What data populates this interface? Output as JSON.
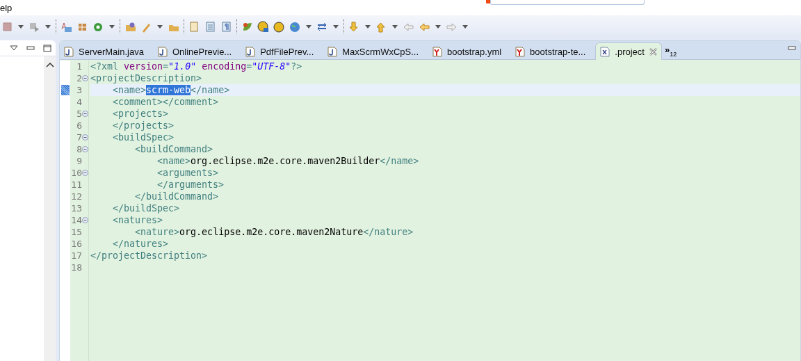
{
  "menu_bar": {
    "items": [
      "elp"
    ]
  },
  "editor": {
    "tabs": [
      {
        "label": "ServerMain.java",
        "kind": "java",
        "selected": false
      },
      {
        "label": "OnlinePrevie...",
        "kind": "java",
        "selected": false
      },
      {
        "label": "PdfFilePrev...",
        "kind": "java",
        "selected": false
      },
      {
        "label": "MaxScrmWxCpS...",
        "kind": "java",
        "selected": false
      },
      {
        "label": "bootstrap.yml",
        "kind": "yaml",
        "selected": false
      },
      {
        "label": "bootstrap-te...",
        "kind": "yaml",
        "selected": false
      },
      {
        "label": ".project",
        "kind": "xml",
        "selected": true
      }
    ],
    "overflow": {
      "symbol": "»",
      "count": "12"
    },
    "lines": [
      {
        "number": "1",
        "foldable": false,
        "current": false,
        "segments": [
          {
            "kind": "tag",
            "text": "<?xml "
          },
          {
            "kind": "attr",
            "text": "version"
          },
          {
            "kind": "tag",
            "text": "="
          },
          {
            "kind": "value",
            "text": "\"1.0\""
          },
          {
            "kind": "attr",
            "text": " encoding"
          },
          {
            "kind": "tag",
            "text": "="
          },
          {
            "kind": "value",
            "text": "\"UTF-8\""
          },
          {
            "kind": "tag",
            "text": "?>"
          }
        ]
      },
      {
        "number": "2",
        "foldable": true,
        "current": false,
        "segments": [
          {
            "kind": "tag",
            "text": "<projectDescription>"
          }
        ]
      },
      {
        "number": "3",
        "foldable": false,
        "current": true,
        "segments": [
          {
            "kind": "tag",
            "text": "    <name>"
          },
          {
            "kind": "text",
            "text": "scrm-web",
            "selected": true
          },
          {
            "kind": "tag",
            "text": "</name>"
          }
        ]
      },
      {
        "number": "4",
        "foldable": false,
        "current": false,
        "segments": [
          {
            "kind": "tag",
            "text": "    <comment></comment>"
          }
        ]
      },
      {
        "number": "5",
        "foldable": true,
        "current": false,
        "segments": [
          {
            "kind": "tag",
            "text": "    <projects>"
          }
        ]
      },
      {
        "number": "6",
        "foldable": false,
        "current": false,
        "segments": [
          {
            "kind": "tag",
            "text": "    </projects>"
          }
        ]
      },
      {
        "number": "7",
        "foldable": true,
        "current": false,
        "segments": [
          {
            "kind": "tag",
            "text": "    <buildSpec>"
          }
        ]
      },
      {
        "number": "8",
        "foldable": true,
        "current": false,
        "segments": [
          {
            "kind": "tag",
            "text": "        <buildCommand>"
          }
        ]
      },
      {
        "number": "9",
        "foldable": false,
        "current": false,
        "segments": [
          {
            "kind": "tag",
            "text": "            <name>"
          },
          {
            "kind": "text",
            "text": "org.eclipse.m2e.core.maven2Builder"
          },
          {
            "kind": "tag",
            "text": "</name>"
          }
        ]
      },
      {
        "number": "10",
        "foldable": true,
        "current": false,
        "segments": [
          {
            "kind": "tag",
            "text": "            <arguments>"
          }
        ]
      },
      {
        "number": "11",
        "foldable": false,
        "current": false,
        "segments": [
          {
            "kind": "tag",
            "text": "            </arguments>"
          }
        ]
      },
      {
        "number": "12",
        "foldable": false,
        "current": false,
        "segments": [
          {
            "kind": "tag",
            "text": "        </buildCommand>"
          }
        ]
      },
      {
        "number": "13",
        "foldable": false,
        "current": false,
        "segments": [
          {
            "kind": "tag",
            "text": "    </buildSpec>"
          }
        ]
      },
      {
        "number": "14",
        "foldable": true,
        "current": false,
        "segments": [
          {
            "kind": "tag",
            "text": "    <natures>"
          }
        ]
      },
      {
        "number": "15",
        "foldable": false,
        "current": false,
        "segments": [
          {
            "kind": "tag",
            "text": "        <nature>"
          },
          {
            "kind": "text",
            "text": "org.eclipse.m2e.core.maven2Nature"
          },
          {
            "kind": "tag",
            "text": "</nature>"
          }
        ]
      },
      {
        "number": "16",
        "foldable": false,
        "current": false,
        "segments": [
          {
            "kind": "tag",
            "text": "    </natures>"
          }
        ]
      },
      {
        "number": "17",
        "foldable": false,
        "current": false,
        "segments": [
          {
            "kind": "tag",
            "text": "</projectDescription>"
          }
        ]
      },
      {
        "number": "18",
        "foldable": false,
        "current": false
      }
    ]
  }
}
